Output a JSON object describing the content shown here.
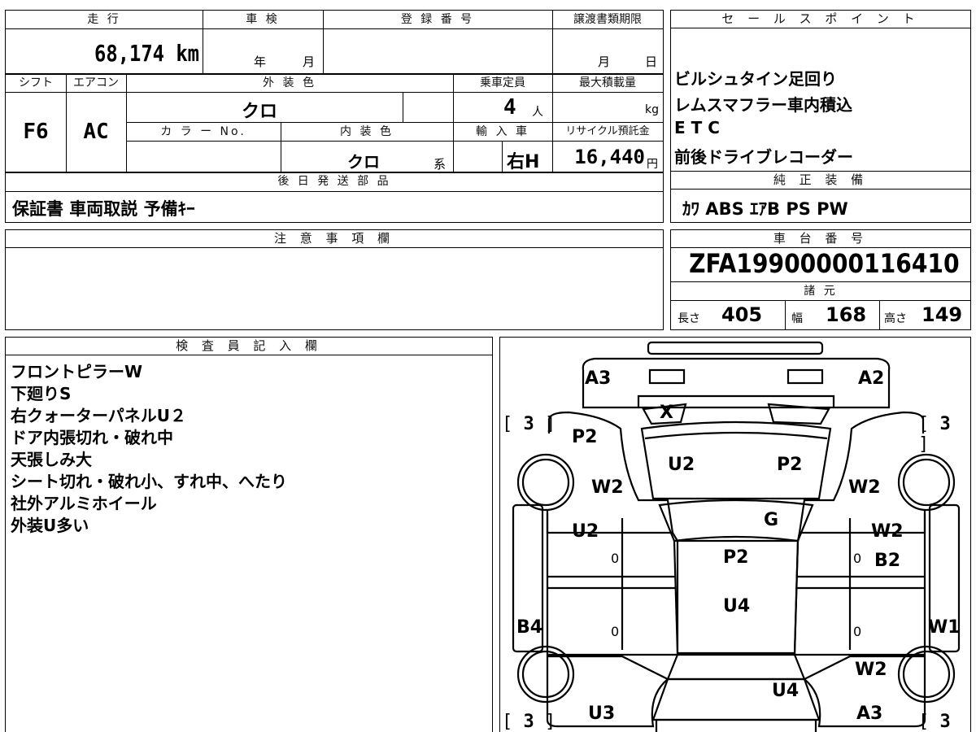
{
  "vehicle": {
    "mileage_label": "走 行",
    "mileage_value": "68,174 km",
    "inspection_label": "車 検",
    "inspection_year": "年",
    "inspection_month": "月",
    "registration_label": "登 録 番 号",
    "transfer_label": "譲渡書類期限",
    "transfer_month": "月",
    "transfer_day": "日",
    "shift_label": "シフト",
    "shift_value": "F6",
    "ac_label": "エアコン",
    "ac_value": "AC",
    "exterior_label": "外 装 色",
    "exterior_value": "クロ",
    "color_no_label": "カ ラ ー No.",
    "interior_label": "内 装 色",
    "interior_value": "クロ",
    "interior_suffix": "系",
    "capacity_label": "乗車定員",
    "capacity_value": "4",
    "capacity_unit": "人",
    "load_label": "最大積載量",
    "load_unit": "kg",
    "import_label": "輸 入 車",
    "import_value": "右H",
    "recycle_label": "リサイクル預託金",
    "recycle_value": "16,440",
    "recycle_unit": "円",
    "later_parts_label": "後 日 発 送 部 品",
    "later_parts_value": "保証書 車両取説 予備ｷｰ",
    "notes_label": "注 意 事 項 欄"
  },
  "sales_points": {
    "label": "セ ー ル ス ポ イ ン ト",
    "lines": [
      "ビルシュタイン足回り",
      "レムスマフラー車内積込",
      "E T C",
      "前後ドライブレコーダー"
    ]
  },
  "equipment": {
    "label": "純 正 装 備",
    "value": "ｶﾜ ABS ｴｱB PS PW"
  },
  "chassis": {
    "label": "車 台 番 号",
    "value": "ZFA19900000116410",
    "spec_label": "諸 元",
    "length_label": "長さ",
    "length_value": "405",
    "width_label": "幅",
    "width_value": "168",
    "height_label": "高さ",
    "height_value": "149"
  },
  "inspector": {
    "label": "検 査 員 記 入 欄",
    "lines": [
      "フロントピラーW",
      "下廻りS",
      "右クォーターパネルU２",
      "ドア内張切れ・破れ中",
      "天張しみ大",
      "シート切れ・破れ小、すれ中、へたり",
      "社外アルミホイール",
      "外装U多い"
    ]
  },
  "diagram": {
    "marks": {
      "a3_top": "A3",
      "a2_top": "A2",
      "x": "X",
      "p2_left": "P2",
      "u2_hood": "U2",
      "p2_hood": "P2",
      "w2_fl": "W2",
      "w2_fr": "W2",
      "g": "G",
      "u2_ld": "U2",
      "p2_roof": "P2",
      "w2_rd": "W2",
      "b2": "B2",
      "u4_roof": "U4",
      "b4": "B4",
      "w1": "W1",
      "w2_rr": "W2",
      "u4_trunk": "U4",
      "u3": "U3",
      "a3_bottom": "A3",
      "zero1": "0",
      "zero2": "0",
      "zero3": "0",
      "zero4": "0"
    },
    "tread": {
      "tl": "3",
      "tr": "3",
      "bl": "3",
      "br": "3"
    }
  }
}
